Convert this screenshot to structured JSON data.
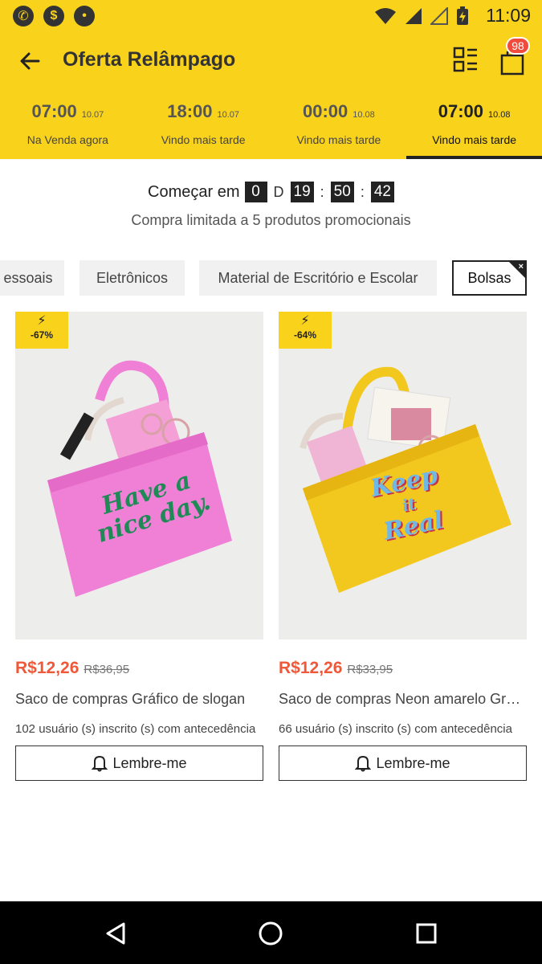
{
  "status_bar": {
    "time": "11:09",
    "left_icons": [
      "whatsapp-icon",
      "dollar-icon",
      "notification-icon"
    ],
    "right_icons": [
      "wifi-icon",
      "signal-icon",
      "signal-alt-icon",
      "battery-charging-icon"
    ]
  },
  "header": {
    "title": "Oferta Relâmpago",
    "cart_count": "98"
  },
  "timeslots": [
    {
      "time": "07:00",
      "date": "10.07",
      "label": "Na Venda agora",
      "active": false
    },
    {
      "time": "18:00",
      "date": "10.07",
      "label": "Vindo mais tarde",
      "active": false
    },
    {
      "time": "00:00",
      "date": "10.08",
      "label": "Vindo mais tarde",
      "active": false
    },
    {
      "time": "07:00",
      "date": "10.08",
      "label": "Vindo mais tarde",
      "active": true
    }
  ],
  "countdown": {
    "prefix": "Começar em",
    "days": "0",
    "days_label": "D",
    "hours": "19",
    "minutes": "50",
    "seconds": "42",
    "separator": ":"
  },
  "limit_text": "Compra limitada a 5 produtos promocionais",
  "categories": [
    {
      "label": "essoais"
    },
    {
      "label": "Eletrônicos"
    },
    {
      "label": "Material de Escritório e Escolar"
    },
    {
      "label": "Bolsas"
    }
  ],
  "category_close": "×",
  "products": [
    {
      "discount": "-67%",
      "bolt": "⚡",
      "bag_text": [
        "Have a",
        "nice day."
      ],
      "price": "R$12,26",
      "old_price": "R$36,95",
      "name": "Saco de compras Gráfico de slogan",
      "subscribers": "102 usuário (s) inscrito (s) com antecedência",
      "button": "Lembre-me",
      "colors": {
        "bag": "#f07fd6",
        "text": "#1f8a56"
      }
    },
    {
      "discount": "-64%",
      "bolt": "⚡",
      "bag_text": [
        "Keep",
        "it",
        "Real"
      ],
      "price": "R$12,26",
      "old_price": "R$33,95",
      "name": "Saco de compras Neon amarelo Gráfico",
      "subscribers": "66 usuário (s) inscrito (s) com antecedência",
      "button": "Lembre-me",
      "colors": {
        "bag": "#f3c81e",
        "text": "#6fb8e6"
      }
    }
  ],
  "nav": [
    "back-triangle-icon",
    "home-circle-icon",
    "recents-square-icon"
  ],
  "colors": {
    "accent": "#f9d21c",
    "price": "#f0583a",
    "badge": "#f04b3c"
  }
}
